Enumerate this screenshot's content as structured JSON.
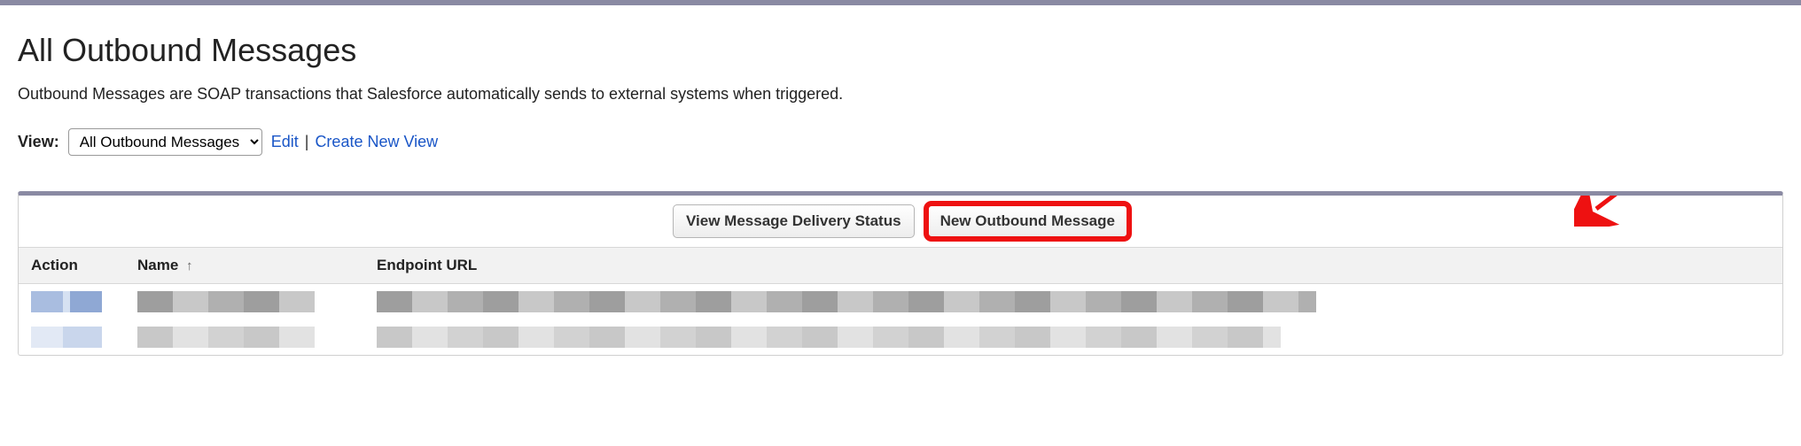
{
  "header": {
    "title": "All Outbound Messages",
    "description": "Outbound Messages are SOAP transactions that Salesforce automatically sends to external systems when triggered."
  },
  "view": {
    "label": "View:",
    "selected": "All Outbound Messages",
    "options": [
      "All Outbound Messages"
    ],
    "edit_label": "Edit",
    "create_label": "Create New View"
  },
  "toolbar": {
    "view_status_label": "View Message Delivery Status",
    "new_message_label": "New Outbound Message"
  },
  "table": {
    "columns": {
      "action": "Action",
      "name": "Name",
      "endpoint": "Endpoint URL"
    },
    "sort": {
      "column": "name",
      "direction": "asc"
    }
  }
}
